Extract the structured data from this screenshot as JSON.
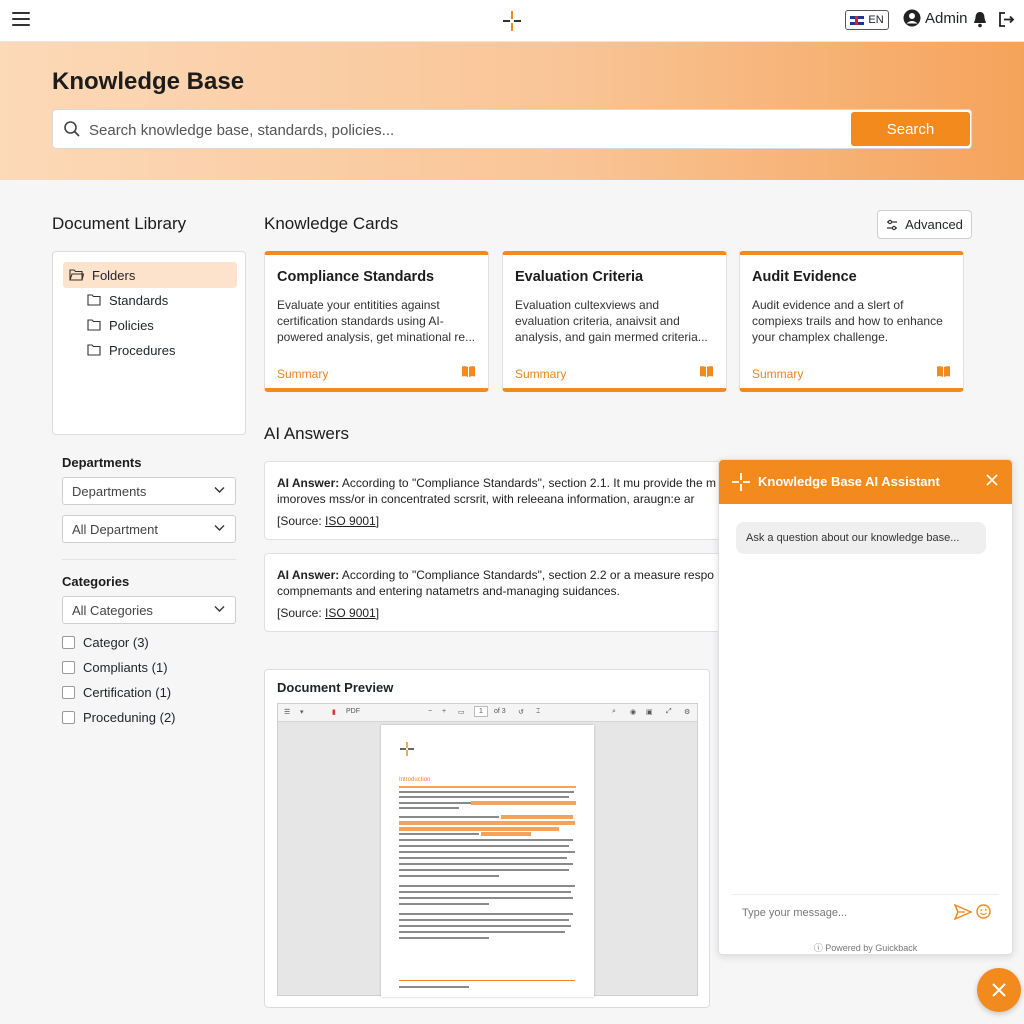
{
  "topbar": {
    "menu_icon": "hamburger-icon",
    "lang_label": "EN",
    "user_label": "Admin",
    "icons": [
      "user-circle-icon",
      "bell-icon",
      "logout-icon"
    ]
  },
  "hero": {
    "title": "Knowledge Base",
    "search_placeholder": "Search knowledge base, standards, policies...",
    "search_button": "Search"
  },
  "library": {
    "title": "Document Library",
    "folders": {
      "root": "Folders",
      "children": [
        "Standards",
        "Policies",
        "Procedures"
      ]
    },
    "departments_label": "Departments",
    "department_selects": [
      "Departments",
      "All Department"
    ],
    "categories_label": "Categories",
    "category_select": "All Categories",
    "category_checks": [
      "Categor (3)",
      "Compliants (1)",
      "Certification (1)",
      "Proceduning (2)"
    ]
  },
  "cards_section": {
    "title": "Knowledge Cards",
    "advanced_label": "Advanced",
    "cards": [
      {
        "title": "Compliance Standards",
        "lines": [
          "Evaluate your entitities against",
          "certification standards using AI-",
          "powered analysis, get minational re..."
        ],
        "summary": "Summary"
      },
      {
        "title": "Evaluation Criteria",
        "lines": [
          "Evaluation cultexviews and",
          "evaluation criteria, anaivsit and",
          "analysis, and gain mermed criteria..."
        ],
        "summary": "Summary"
      },
      {
        "title": "Audit Evidence",
        "lines": [
          "Audit evidence and a slert of",
          "compiexs trails and how to enhance",
          "your champlex challenge."
        ],
        "summary": "Summary"
      }
    ]
  },
  "answers": {
    "title": "AI Answers",
    "items": [
      {
        "label": "AI Answer:",
        "line1": " According to \"Compliance Standards\", section 2.1. It mu provide the m",
        "line2": "imoroves mss/or in concentrated scrsrit, with releeana information, araugn:e ar",
        "source_prefix": "[Source: ",
        "source_link": "ISO 9001",
        "source_suffix": "]"
      },
      {
        "label": "AI Answer:",
        "line1": " According to \"Compliance Standards\", section 2.2 or a measure respo",
        "line2": "compnemants and entering natametrs and-managing suidances.",
        "source_prefix": "[Source: ",
        "source_link": "ISO 9001",
        "source_suffix": "]"
      }
    ]
  },
  "preview": {
    "title": "Document Preview",
    "toolbar_type": "PDF",
    "page_current": "1",
    "page_total": "of 3",
    "section_heading": "Introduction"
  },
  "chat": {
    "title": "Knowledge Base AI Assistant",
    "bubble": "Ask a question about our knowledge base...",
    "input_placeholder": "Type your message...",
    "powered": "Powered by Guickback"
  },
  "colors": {
    "accent": "#f28a1e",
    "accent_light": "#fde3cb"
  }
}
